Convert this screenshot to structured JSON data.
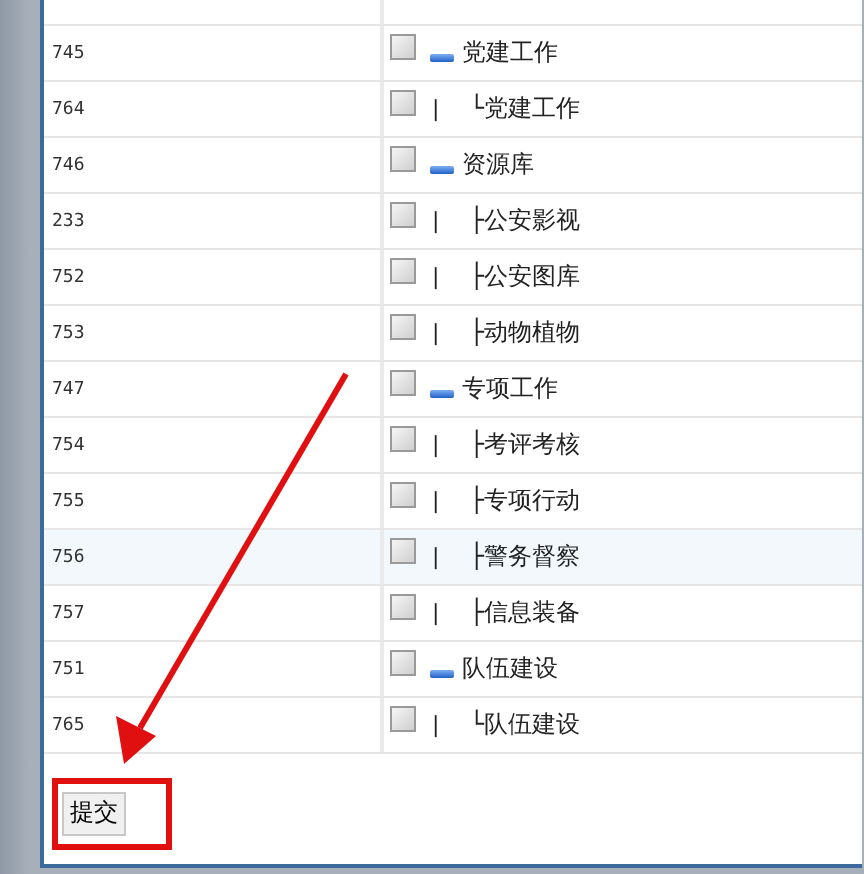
{
  "rows": [
    {
      "id": "745",
      "label": "党建工作",
      "expanded": true,
      "checked": false,
      "highlighted": false,
      "children": [
        {
          "id": "764",
          "guide": "|",
          "label": "└党建工作",
          "checked": false,
          "highlighted": false
        }
      ]
    },
    {
      "id": "746",
      "label": "资源库",
      "expanded": true,
      "checked": false,
      "highlighted": false,
      "children": [
        {
          "id": "233",
          "guide": "|",
          "label": "├公安影视",
          "checked": false,
          "highlighted": false
        },
        {
          "id": "752",
          "guide": "|",
          "label": "├公安图库",
          "checked": false,
          "highlighted": false
        },
        {
          "id": "753",
          "guide": "|",
          "label": "├动物植物",
          "checked": false,
          "highlighted": false
        }
      ]
    },
    {
      "id": "747",
      "label": "专项工作",
      "expanded": true,
      "checked": false,
      "highlighted": false,
      "children": [
        {
          "id": "754",
          "guide": "|",
          "label": "├考评考核",
          "checked": false,
          "highlighted": false
        },
        {
          "id": "755",
          "guide": "|",
          "label": "├专项行动",
          "checked": false,
          "highlighted": false
        },
        {
          "id": "756",
          "guide": "|",
          "label": "├警务督察",
          "checked": false,
          "highlighted": true
        },
        {
          "id": "757",
          "guide": "|",
          "label": "├信息装备",
          "checked": false,
          "highlighted": false
        }
      ]
    },
    {
      "id": "751",
      "label": "队伍建设",
      "expanded": true,
      "checked": false,
      "highlighted": false,
      "children": [
        {
          "id": "765",
          "guide": "|",
          "label": "└队伍建设",
          "checked": false,
          "highlighted": false
        }
      ]
    }
  ],
  "submit_button": "提交"
}
